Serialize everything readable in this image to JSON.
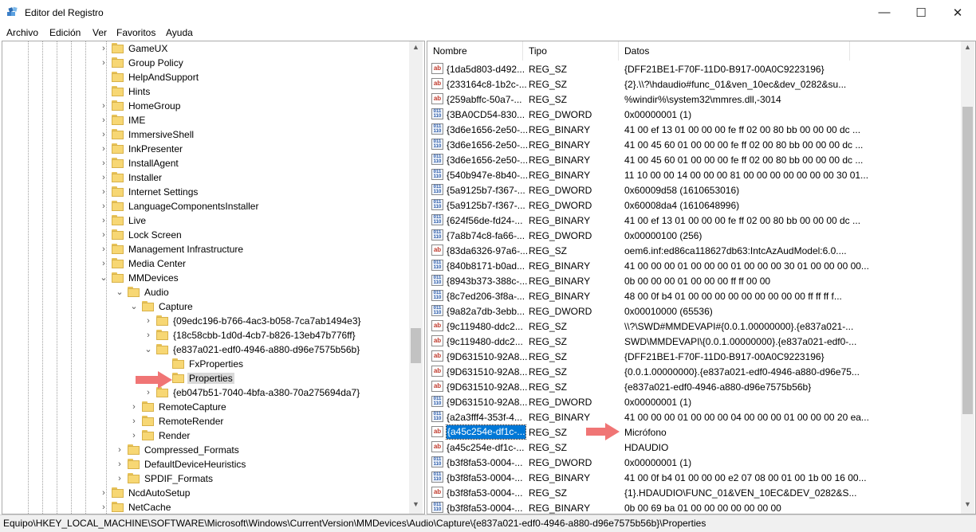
{
  "window": {
    "title": "Editor del Registro",
    "minimize": "—",
    "maximize": "☐",
    "close": "✕"
  },
  "menu": [
    "Archivo",
    "Edición",
    "Ver",
    "Favoritos",
    "Ayuda"
  ],
  "tree": [
    {
      "label": "GameUX",
      "depth": 0,
      "chev": "›"
    },
    {
      "label": "Group Policy",
      "depth": 0,
      "chev": "›"
    },
    {
      "label": "HelpAndSupport",
      "depth": 0,
      "chev": ""
    },
    {
      "label": "Hints",
      "depth": 0,
      "chev": ""
    },
    {
      "label": "HomeGroup",
      "depth": 0,
      "chev": "›"
    },
    {
      "label": "IME",
      "depth": 0,
      "chev": "›"
    },
    {
      "label": "ImmersiveShell",
      "depth": 0,
      "chev": "›"
    },
    {
      "label": "InkPresenter",
      "depth": 0,
      "chev": "›"
    },
    {
      "label": "InstallAgent",
      "depth": 0,
      "chev": "›"
    },
    {
      "label": "Installer",
      "depth": 0,
      "chev": "›"
    },
    {
      "label": "Internet Settings",
      "depth": 0,
      "chev": "›"
    },
    {
      "label": "LanguageComponentsInstaller",
      "depth": 0,
      "chev": "›"
    },
    {
      "label": "Live",
      "depth": 0,
      "chev": "›"
    },
    {
      "label": "Lock Screen",
      "depth": 0,
      "chev": "›"
    },
    {
      "label": "Management Infrastructure",
      "depth": 0,
      "chev": "›"
    },
    {
      "label": "Media Center",
      "depth": 0,
      "chev": "›"
    },
    {
      "label": "MMDevices",
      "depth": 0,
      "chev": "⌄"
    },
    {
      "label": "Audio",
      "depth": 1,
      "chev": "⌄"
    },
    {
      "label": "Capture",
      "depth": 2,
      "chev": "⌄"
    },
    {
      "label": "{09edc196-b766-4ac3-b058-7ca7ab1494e3}",
      "depth": 3,
      "chev": "›"
    },
    {
      "label": "{18c58cbb-1d0d-4cb7-b826-13eb47b776ff}",
      "depth": 3,
      "chev": "›"
    },
    {
      "label": "{e837a021-edf0-4946-a880-d96e7575b56b}",
      "depth": 3,
      "chev": "⌄"
    },
    {
      "label": "FxProperties",
      "depth": 4,
      "chev": ""
    },
    {
      "label": "Properties",
      "depth": 4,
      "chev": "",
      "selected": true
    },
    {
      "label": "{eb047b51-7040-4bfa-a380-70a275694da7}",
      "depth": 3,
      "chev": "›"
    },
    {
      "label": "RemoteCapture",
      "depth": 2,
      "chev": "›"
    },
    {
      "label": "RemoteRender",
      "depth": 2,
      "chev": "›"
    },
    {
      "label": "Render",
      "depth": 2,
      "chev": "›"
    },
    {
      "label": "Compressed_Formats",
      "depth": 1,
      "chev": "›"
    },
    {
      "label": "DefaultDeviceHeuristics",
      "depth": 1,
      "chev": "›"
    },
    {
      "label": "SPDIF_Formats",
      "depth": 1,
      "chev": "›"
    },
    {
      "label": "NcdAutoSetup",
      "depth": 0,
      "chev": "›"
    },
    {
      "label": "NetCache",
      "depth": 0,
      "chev": "›"
    }
  ],
  "columns": [
    "Nombre",
    "Tipo",
    "Datos"
  ],
  "rows": [
    {
      "name": "{1da5d803-d492...",
      "type": "REG_SZ",
      "data": "{DFF21BE1-F70F-11D0-B917-00A0C9223196}",
      "icon": "sz"
    },
    {
      "name": "{233164c8-1b2c-...",
      "type": "REG_SZ",
      "data": "{2}.\\\\?\\hdaudio#func_01&ven_10ec&dev_0282&su...",
      "icon": "sz"
    },
    {
      "name": "{259abffc-50a7-...",
      "type": "REG_SZ",
      "data": "%windir%\\system32\\mmres.dll,-3014",
      "icon": "sz"
    },
    {
      "name": "{3BA0CD54-830...",
      "type": "REG_DWORD",
      "data": "0x00000001 (1)",
      "icon": "bin"
    },
    {
      "name": "{3d6e1656-2e50-...",
      "type": "REG_BINARY",
      "data": "41 00 ef 13 01 00 00 00 fe ff 02 00 80 bb 00 00 00 dc ...",
      "icon": "bin"
    },
    {
      "name": "{3d6e1656-2e50-...",
      "type": "REG_BINARY",
      "data": "41 00 45 60 01 00 00 00 fe ff 02 00 80 bb 00 00 00 dc ...",
      "icon": "bin"
    },
    {
      "name": "{3d6e1656-2e50-...",
      "type": "REG_BINARY",
      "data": "41 00 45 60 01 00 00 00 fe ff 02 00 80 bb 00 00 00 dc ...",
      "icon": "bin"
    },
    {
      "name": "{540b947e-8b40-...",
      "type": "REG_BINARY",
      "data": "11 10 00 00 14 00 00 00 81 00 00 00 00 00 00 00 30 01...",
      "icon": "bin"
    },
    {
      "name": "{5a9125b7-f367-...",
      "type": "REG_DWORD",
      "data": "0x60009d58 (1610653016)",
      "icon": "bin"
    },
    {
      "name": "{5a9125b7-f367-...",
      "type": "REG_DWORD",
      "data": "0x60008da4 (1610648996)",
      "icon": "bin"
    },
    {
      "name": "{624f56de-fd24-...",
      "type": "REG_BINARY",
      "data": "41 00 ef 13 01 00 00 00 fe ff 02 00 80 bb 00 00 00 dc ...",
      "icon": "bin"
    },
    {
      "name": "{7a8b74c8-fa66-...",
      "type": "REG_DWORD",
      "data": "0x00000100 (256)",
      "icon": "bin"
    },
    {
      "name": "{83da6326-97a6-...",
      "type": "REG_SZ",
      "data": "oem6.inf:ed86ca118627db63:IntcAzAudModel:6.0....",
      "icon": "sz"
    },
    {
      "name": "{840b8171-b0ad...",
      "type": "REG_BINARY",
      "data": "41 00 00 00 01 00 00 00 01 00 00 00 30 01 00 00 00 00...",
      "icon": "bin"
    },
    {
      "name": "{8943b373-388c-...",
      "type": "REG_BINARY",
      "data": "0b 00 00 00 01 00 00 00 ff ff 00 00",
      "icon": "bin"
    },
    {
      "name": "{8c7ed206-3f8a-...",
      "type": "REG_BINARY",
      "data": "48 00 0f b4 01 00 00 00 00 00 00 00 00 00 ff ff ff f...",
      "icon": "bin"
    },
    {
      "name": "{9a82a7db-3ebb...",
      "type": "REG_DWORD",
      "data": "0x00010000 (65536)",
      "icon": "bin"
    },
    {
      "name": "{9c119480-ddc2...",
      "type": "REG_SZ",
      "data": "\\\\?\\SWD#MMDEVAPI#{0.0.1.00000000}.{e837a021-...",
      "icon": "sz"
    },
    {
      "name": "{9c119480-ddc2...",
      "type": "REG_SZ",
      "data": "SWD\\MMDEVAPI\\{0.0.1.00000000}.{e837a021-edf0-...",
      "icon": "sz"
    },
    {
      "name": "{9D631510-92A8...",
      "type": "REG_SZ",
      "data": "{DFF21BE1-F70F-11D0-B917-00A0C9223196}",
      "icon": "sz"
    },
    {
      "name": "{9D631510-92A8...",
      "type": "REG_SZ",
      "data": "{0.0.1.00000000}.{e837a021-edf0-4946-a880-d96e75...",
      "icon": "sz"
    },
    {
      "name": "{9D631510-92A8...",
      "type": "REG_SZ",
      "data": "{e837a021-edf0-4946-a880-d96e7575b56b}",
      "icon": "sz"
    },
    {
      "name": "{9D631510-92A8...",
      "type": "REG_DWORD",
      "data": "0x00000001 (1)",
      "icon": "bin"
    },
    {
      "name": "{a2a3fff4-353f-4...",
      "type": "REG_BINARY",
      "data": "41 00 00 00 01 00 00 00 04 00 00 00 01 00 00 00 20 ea...",
      "icon": "bin"
    },
    {
      "name": "{a45c254e-df1c-...",
      "type": "REG_SZ",
      "data": "Micrófono",
      "icon": "sz",
      "selected": true
    },
    {
      "name": "{a45c254e-df1c-...",
      "type": "REG_SZ",
      "data": "HDAUDIO",
      "icon": "sz"
    },
    {
      "name": "{b3f8fa53-0004-...",
      "type": "REG_DWORD",
      "data": "0x00000001 (1)",
      "icon": "bin"
    },
    {
      "name": "{b3f8fa53-0004-...",
      "type": "REG_BINARY",
      "data": "41 00 0f b4 01 00 00 00 e2 07 08 00 01 00 1b 00 16 00...",
      "icon": "bin"
    },
    {
      "name": "{b3f8fa53-0004-...",
      "type": "REG_SZ",
      "data": "{1}.HDAUDIO\\FUNC_01&VEN_10EC&DEV_0282&S...",
      "icon": "sz"
    },
    {
      "name": "{b3f8fa53-0004-...",
      "type": "REG_BINARY",
      "data": "0b 00 69 ba 01 00 00 00 00 00 00 00",
      "icon": "bin"
    }
  ],
  "status": "Equipo\\HKEY_LOCAL_MACHINE\\SOFTWARE\\Microsoft\\Windows\\CurrentVersion\\MMDevices\\Audio\\Capture\\{e837a021-edf0-4946-a880-d96e7575b56b}\\Properties",
  "icons": {
    "string": "ab",
    "binary": "011 110"
  },
  "colors": {
    "selection": "#0078d7",
    "annotation_arrow": "#f07575",
    "folder": "#f7d774"
  }
}
